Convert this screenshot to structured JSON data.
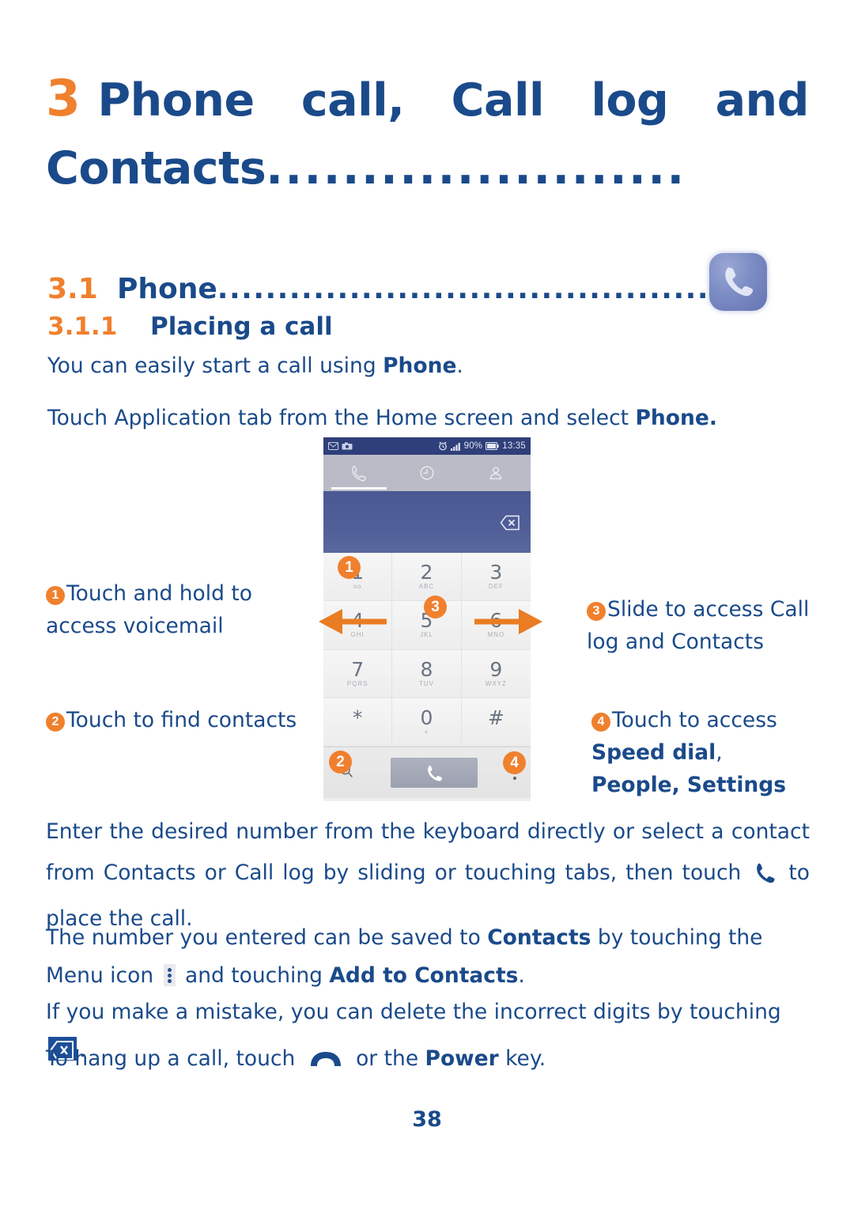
{
  "chapter": {
    "number": "3",
    "words": [
      "Phone",
      "call,",
      "Call",
      "log",
      "and"
    ],
    "line2": "Contacts",
    "line2_dots": "......................"
  },
  "sections": {
    "s31": {
      "number": "3.1",
      "label": "Phone",
      "dots": "................................................................."
    },
    "s311": {
      "number": "3.1.1",
      "label": "Placing a call"
    }
  },
  "app_icon_name": "phone-app-icon",
  "paragraphs": {
    "p1_a": "You can easily start a call using ",
    "p1_b": "Phone",
    "p1_c": ".",
    "p2_a": "Touch Application tab from the Home screen and select ",
    "p2_b": "Phone.",
    "p3_a": "Enter the desired number from the keyboard directly or select a contact from Contacts or Call log by sliding or touching tabs, then touch ",
    "p3_b": " to place the call.",
    "p4_a": "The number you entered can be saved to ",
    "p4_b": "Contacts",
    "p4_c": " by touching the Menu icon ",
    "p4_d": " and touching ",
    "p4_e": "Add to Contacts",
    "p4_f": ".",
    "p5_a": "If you make a mistake, you can delete the incorrect digits by touching ",
    "p5_b": ".",
    "p6_a": "To hang up a call, touch ",
    "p6_b": " or the ",
    "p6_c": "Power",
    "p6_d": " key."
  },
  "callouts": [
    {
      "num": "1",
      "text": "Touch and hold to access voicemail"
    },
    {
      "num": "2",
      "text": "Touch to find contacts"
    },
    {
      "num": "3",
      "text": "Slide to access Call log and Contacts"
    },
    {
      "num": "4",
      "text": "Touch to access ",
      "bold1": "Speed dial",
      "comma": ",",
      "bold2": "People, Settings"
    }
  ],
  "phone": {
    "status_bar": {
      "battery_percent": "90%",
      "time": "13:35",
      "left_icons": [
        "message-icon",
        "camera-icon"
      ],
      "right_icons": [
        "alarm-icon",
        "signal-icon",
        "battery-icon"
      ]
    },
    "tabs": [
      {
        "name": "dialer-tab",
        "icon": "handset-icon",
        "active": true
      },
      {
        "name": "call-log-tab",
        "icon": "clock-icon",
        "active": false
      },
      {
        "name": "contacts-tab",
        "icon": "person-icon",
        "active": false
      }
    ],
    "delete_icon": "backspace-icon",
    "keys": [
      {
        "digit": "1",
        "letters": "oo"
      },
      {
        "digit": "2",
        "letters": "ABC"
      },
      {
        "digit": "3",
        "letters": "DEF"
      },
      {
        "digit": "4",
        "letters": "GHI"
      },
      {
        "digit": "5",
        "letters": "JKL"
      },
      {
        "digit": "6",
        "letters": "MNO"
      },
      {
        "digit": "7",
        "letters": "PQRS"
      },
      {
        "digit": "8",
        "letters": "TUV"
      },
      {
        "digit": "9",
        "letters": "WXYZ"
      },
      {
        "digit": "*",
        "letters": ""
      },
      {
        "digit": "0",
        "letters": "+"
      },
      {
        "digit": "#",
        "letters": ""
      }
    ],
    "bottom_bar": {
      "search_icon": "search-icon",
      "call_button_icon": "handset-icon",
      "menu_icon": "overflow-menu-icon"
    },
    "overlay_badges": [
      "1",
      "3",
      "2",
      "4"
    ]
  },
  "page_number": "38",
  "colors": {
    "heading_blue": "#1a4a8a",
    "accent_orange": "#f0802d",
    "status_bar_blue": "#2f3f7a",
    "dial_display_blue": "#505e98"
  }
}
